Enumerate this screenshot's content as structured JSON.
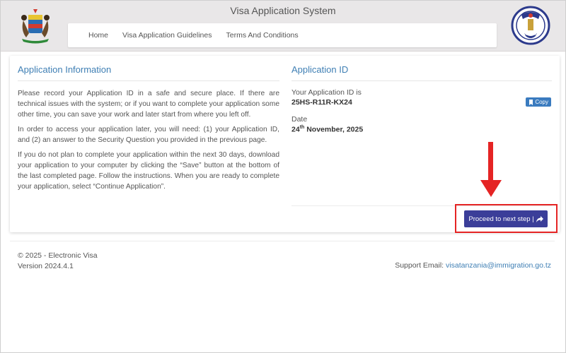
{
  "header": {
    "title": "Visa Application System",
    "nav": [
      "Home",
      "Visa Application Guidelines",
      "Terms And Conditions"
    ],
    "left_logo_icon": "coat-of-arms-icon",
    "right_logo_icon": "immigration-badge-icon",
    "right_logo_text": "TANZANIA"
  },
  "application_info": {
    "title": "Application Information",
    "paragraphs": [
      "Please record your Application ID in a safe and secure place. If there are technical issues with the system; or if you want to complete your application some other time, you can save your work and later start from where you left off.",
      "In order to access your application later, you will need: (1) your Application ID, and (2) an answer to the Security Question you provided in the previous page.",
      "If you do not plan to complete your application within the next 30 days, download your application to your computer by clicking the “Save” button at the bottom of the last completed page. Follow the instructions. When you are ready to complete your application, select “Continue Application”."
    ]
  },
  "application_id": {
    "title": "Application ID",
    "id_label": "Your Application ID is",
    "id_value": "25HS-R11R-KX24",
    "copy_label": "Copy",
    "date_label": "Date",
    "date_day": "24",
    "date_suffix": "th",
    "date_rest": " November, 2025"
  },
  "actions": {
    "proceed_label": "Proceed to next step |",
    "proceed_icon": "share-arrow-icon"
  },
  "footer": {
    "copyright": "© 2025 - Electronic Visa",
    "version": "Version 2024.4.1",
    "support_label": "Support Email:",
    "support_email": "visatanzania@immigration.go.tz"
  },
  "colors": {
    "accent_blue": "#3f7fb4",
    "button_navy": "#3b3e99",
    "highlight_red": "#e52424"
  }
}
